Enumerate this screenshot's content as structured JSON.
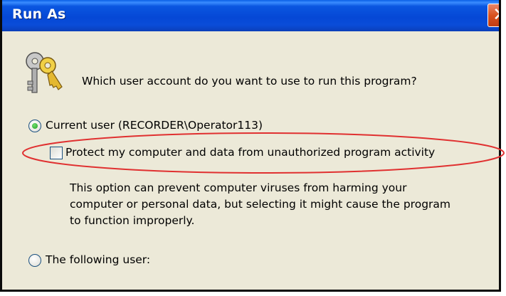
{
  "window": {
    "title": "Run As"
  },
  "prompt": "Which user account do you want to use to run this program?",
  "options": {
    "current_user": {
      "label": "Current user (RECORDER\\Operator113)",
      "selected": true
    },
    "protect": {
      "label": "Protect my computer and data from unauthorized program activity",
      "checked": false,
      "description_lines": [
        "This option can prevent computer viruses from harming your",
        "computer or personal data, but selecting it might cause the program",
        "to function improperly."
      ]
    },
    "following_user": {
      "label": "The following user:",
      "selected": false
    }
  },
  "icons": {
    "keys": "keys-icon",
    "close": "close-icon"
  },
  "colors": {
    "title_bar": "#0548d6",
    "dialog_bg": "#ece9d8",
    "close": "#d9521f",
    "highlight_ellipse": "#e03030",
    "radio_dot": "#21a121"
  }
}
